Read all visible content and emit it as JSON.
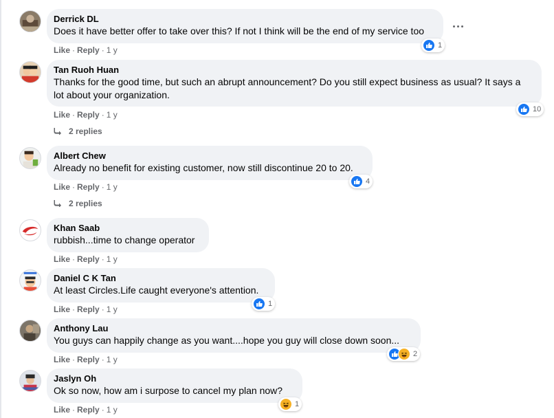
{
  "actions": {
    "like": "Like",
    "reply": "Reply",
    "separator": "·"
  },
  "comments": [
    {
      "author": "Derrick DL",
      "text": "Does it have better offer to take over this? If not I think will be the end of my service too",
      "time": "1 y",
      "reactions": {
        "types": [
          "like"
        ],
        "count": "1"
      }
    },
    {
      "author": "Tan Ruoh Huan",
      "text": "Thanks for the good time, but such an abrupt announcement? Do you still expect business as usual? It says a lot about your organization.",
      "time": "1 y",
      "reactions": {
        "types": [
          "like"
        ],
        "count": "10"
      },
      "replies": "2 replies"
    },
    {
      "author": "Albert Chew",
      "text": "Already no benefit for existing customer, now still discontinue 20 to 20.",
      "time": "1 y",
      "reactions": {
        "types": [
          "like"
        ],
        "count": "4"
      },
      "replies": "2 replies"
    },
    {
      "author": "Khan Saab",
      "text": "rubbish...time to change operator",
      "time": "1 y"
    },
    {
      "author": "Daniel C K Tan",
      "text": "At least Circles.Life caught everyone's attention.",
      "time": "1 y",
      "reactions": {
        "types": [
          "like"
        ],
        "count": "1"
      }
    },
    {
      "author": "Anthony Lau",
      "text": "You guys can happily change as you want....hope you guy will close down soon...",
      "time": "1 y",
      "reactions": {
        "types": [
          "like",
          "haha"
        ],
        "count": "2"
      }
    },
    {
      "author": "Jaslyn Oh",
      "text": "Ok so now, how am i surpose to cancel my plan now?",
      "time": "1 y",
      "reactions": {
        "types": [
          "haha"
        ],
        "count": "1"
      }
    }
  ],
  "colors": {
    "bubble": "#f0f2f5",
    "like": "#1877f2",
    "haha": "#f7b125",
    "meta": "#65676b"
  },
  "icons": {
    "more": "more-dots-icon",
    "reply_arrow": "reply-arrow-icon",
    "like": "like-reaction-icon",
    "haha": "haha-reaction-icon"
  }
}
